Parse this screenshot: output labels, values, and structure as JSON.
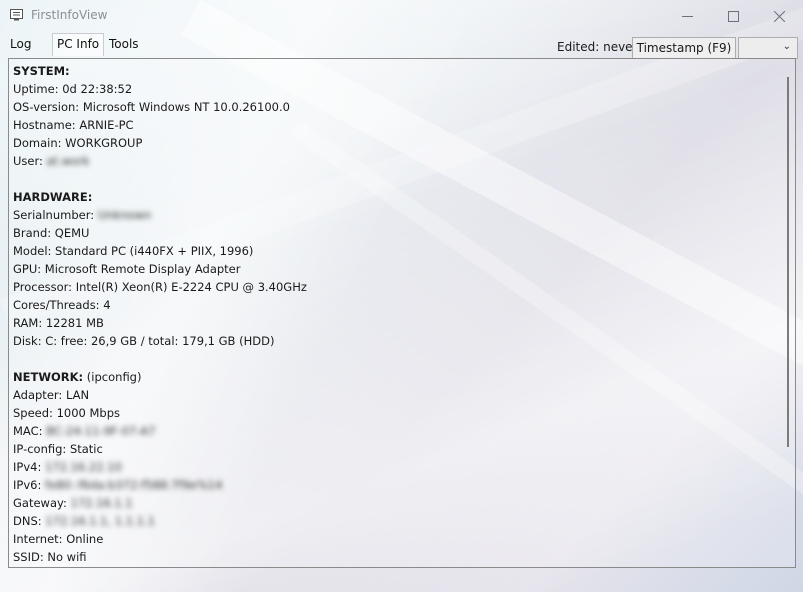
{
  "window": {
    "title": "FirstInfoView"
  },
  "tabs": [
    {
      "label": "Log"
    },
    {
      "label": "PC Info"
    },
    {
      "label": "Tools"
    }
  ],
  "toolbar": {
    "edited_label": "Edited: never",
    "timestamp_label": "Timestamp (F9)",
    "dropdown_value": ""
  },
  "info": {
    "system": {
      "heading": "SYSTEM:",
      "uptime": "Uptime: 0d 22:38:52",
      "os": "OS-version: Microsoft Windows NT 10.0.26100.0",
      "hostname": "Hostname: ARNIE-PC",
      "domain": "Domain: WORKGROUP",
      "user_label": "User:",
      "user_value": "at.work"
    },
    "hardware": {
      "heading": "HARDWARE:",
      "serial_label": "Serialnumber:",
      "serial_value": "Unknown",
      "brand": "Brand: QEMU",
      "model": "Model: Standard PC (i440FX + PIIX, 1996)",
      "gpu": "GPU: Microsoft Remote Display Adapter",
      "processor": "Processor: Intel(R) Xeon(R) E-2224 CPU @ 3.40GHz",
      "cores": "Cores/Threads: 4",
      "ram": "RAM: 12281 MB",
      "disk": "Disk: C: free: 26,9 GB / total: 179,1 GB (HDD)"
    },
    "network": {
      "heading": "NETWORK:",
      "heading_suffix": " (ipconfig)",
      "adapter": "Adapter: LAN",
      "speed": "Speed: 1000 Mbps",
      "mac_label": "MAC:",
      "mac_value": "BC-24-11-9F-07-A7",
      "ipconfig": "IP-config: Static",
      "ipv4_label": "IPv4:",
      "ipv4_value": "172.16.22.10",
      "ipv6_label": "IPv6:",
      "ipv6_value": "fe80::f6da:b372:f588:7f9e%14",
      "gateway_label": "Gateway:",
      "gateway_value": "172.16.1.1",
      "dns_label": "DNS:",
      "dns_value": "172.16.1.1, 1.1.1.1",
      "internet": "Internet: Online",
      "ssid": "SSID: No wifi"
    }
  }
}
